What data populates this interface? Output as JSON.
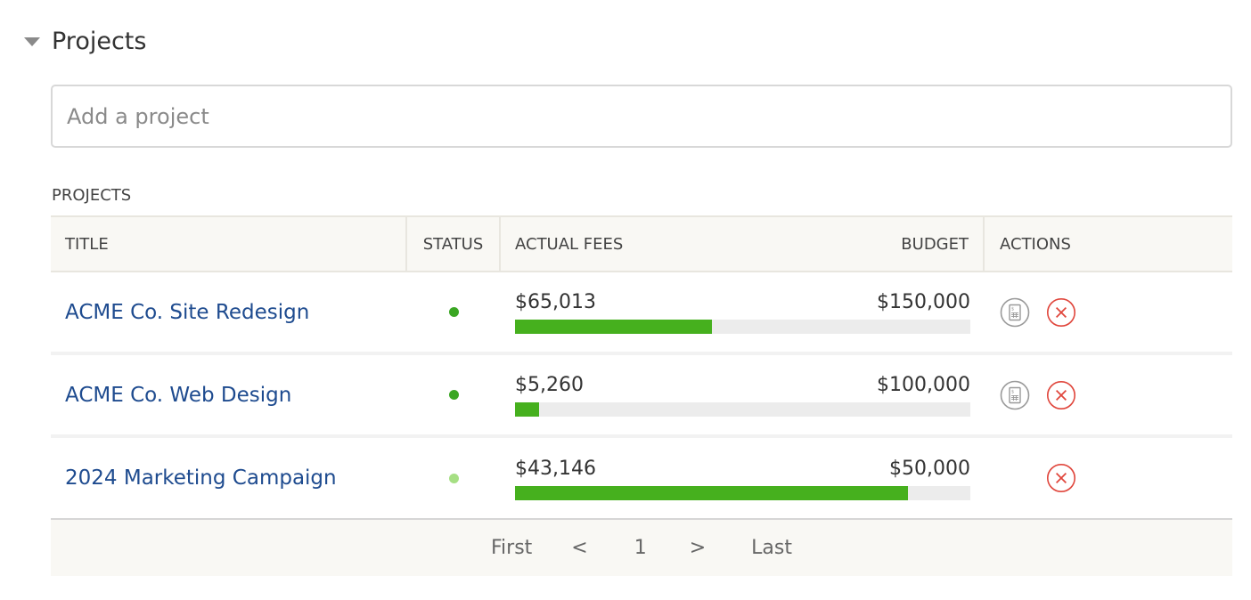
{
  "section": {
    "title": "Projects"
  },
  "add_project": {
    "placeholder": "Add a project",
    "value": ""
  },
  "table": {
    "caption": "PROJECTS",
    "headers": {
      "title": "TITLE",
      "status": "STATUS",
      "actual_fees": "ACTUAL FEES",
      "budget": "BUDGET",
      "actions": "ACTIONS"
    },
    "rows": [
      {
        "title": "ACME Co. Site Redesign",
        "status_color": "#3aa623",
        "actual_fees": "$65,013",
        "budget": "$150,000",
        "progress": 0.4334,
        "actions": [
          "invoice-icon",
          "remove-icon"
        ]
      },
      {
        "title": "ACME Co. Web Design",
        "status_color": "#3aa623",
        "actual_fees": "$5,260",
        "budget": "$100,000",
        "progress": 0.0526,
        "actions": [
          "invoice-icon",
          "remove-icon"
        ]
      },
      {
        "title": "2024 Marketing Campaign",
        "status_color": "#a6df84",
        "actual_fees": "$43,146",
        "budget": "$50,000",
        "progress": 0.8629,
        "actions": [
          "remove-icon"
        ]
      }
    ]
  },
  "pagination": {
    "first": "First",
    "prev": "<",
    "current": "1",
    "next": ">",
    "last": "Last"
  },
  "colors": {
    "link": "#1e4b8f",
    "progress_fill": "#46b01e",
    "progress_track": "#ececec",
    "remove_icon": "#e0463c",
    "invoice_icon": "#9a9a9a",
    "header_bg": "#f9f8f4"
  }
}
